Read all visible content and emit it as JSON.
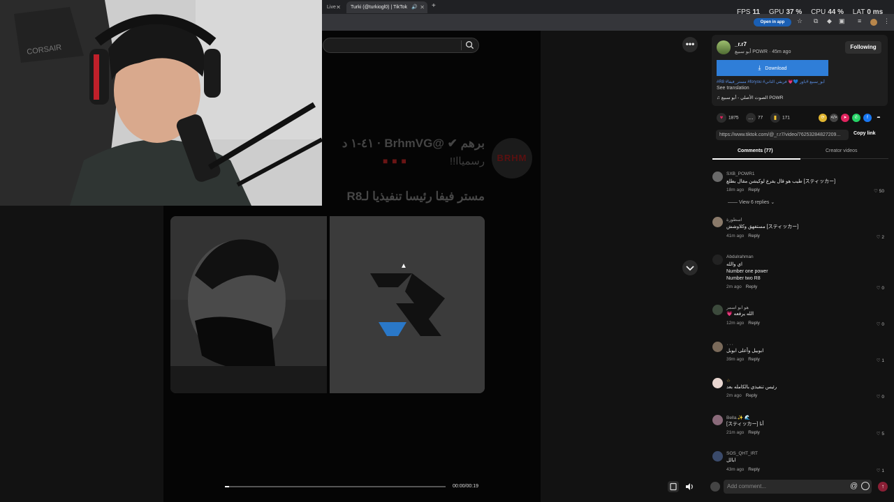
{
  "browser": {
    "tabs": [
      {
        "label": "Live -"
      },
      {
        "label": "Turki (@turkiogl0) | TikTok"
      }
    ],
    "open_in_app": "Open in app"
  },
  "stats": {
    "fps_label": "FPS",
    "fps": "11",
    "gpu_label": "GPU",
    "gpu": "37 %",
    "cpu_label": "CPU",
    "cpu": "44 %",
    "lat_label": "LAT",
    "lat": "0 ms"
  },
  "video": {
    "overlay_title": "برهم ✔ @BrhmVG · ٤١-١ د",
    "overlay_sub": "رسمياا!!",
    "overlay_main": "مستر فيفا رئيسا تنفيذيا لـR8",
    "logo_text": "BRHM",
    "progress": 0.02,
    "timecode": "00:00/00:19"
  },
  "post": {
    "username": "_r.r7",
    "subline": "أبو سبيع POWR · 45m ago",
    "follow": "Following",
    "download": "Download",
    "caption": "#R8 #مستر_فيفا #foryou #أبو_سبيع #باور 💙💗 فريقي الثاني",
    "see_translation": "See translation",
    "sound": "♫ الصوت الأصلي - أبو سبيع POWR",
    "likes": "1875",
    "comments": "77",
    "saves": "171",
    "link": "https://www.tiktok.com/@_r.r7/video/76253284827209...",
    "copy_link": "Copy link"
  },
  "tabs": {
    "comments": "Comments (77)",
    "creator_videos": "Creator videos"
  },
  "comments": [
    {
      "user": "SXB_POWR1",
      "text": "طيب هو قال يفرع لوكيشن مقال بطلع [スティッカー]",
      "time": "18m ago",
      "reply": "Reply",
      "likes": "50",
      "view_replies": "View 6 replies ⌄"
    },
    {
      "user": "اسطورة",
      "text": "مستفهق وكلاوشش [スティッカー]",
      "time": "41m ago",
      "reply": "Reply",
      "likes": "2"
    },
    {
      "user": "Abdulrahman",
      "text": "اي والله",
      "text2": "Number one power",
      "text3": "Number two R8",
      "time": "2m ago",
      "reply": "Reply",
      "likes": "0"
    },
    {
      "user": "هو ابو اسمر",
      "text": "💗 الله يرفعه",
      "time": "12m ago",
      "reply": "Reply",
      "likes": "0"
    },
    {
      "user": "٠٠٠",
      "text": "ابوبيل وأعلى ابوبل",
      "time": "39m ago",
      "reply": "Reply",
      "likes": "1"
    },
    {
      "user": "☆",
      "text": "رئيس تنفيذي بالكامله بعد",
      "time": "2m ago",
      "reply": "Reply",
      "likes": "0"
    },
    {
      "user": "Bella.✨ 🌊",
      "text": "[スティッカー] أنا",
      "time": "21m ago",
      "reply": "Reply",
      "likes": "5"
    },
    {
      "user": "SOS_QHT_IRT",
      "text": "ابالل",
      "time": "43m ago",
      "reply": "Reply",
      "likes": "1"
    }
  ],
  "composer": {
    "placeholder": "Add comment...",
    "at": "@"
  },
  "colors": {
    "accent": "#2f7ed8",
    "like": "#e0245e",
    "background": "#121212"
  }
}
